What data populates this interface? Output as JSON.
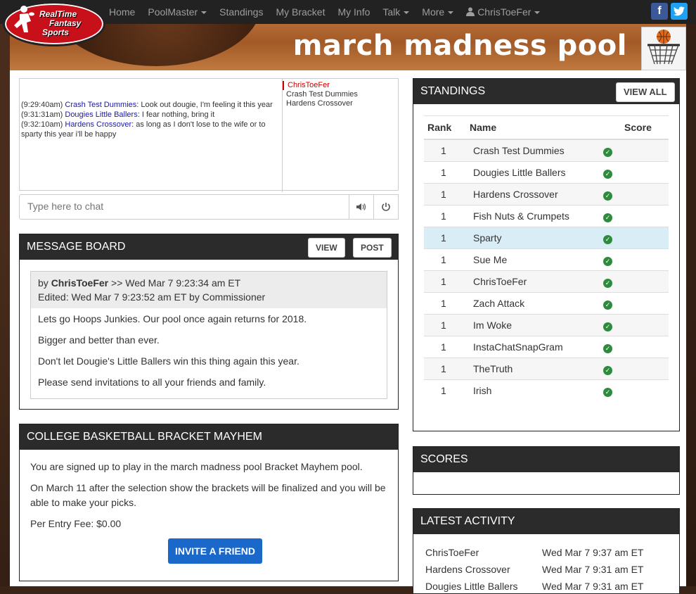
{
  "brand": {
    "line1": "RealTime",
    "line2": "Fantasy",
    "line3": "Sports"
  },
  "nav": {
    "home": "Home",
    "poolmaster": "PoolMaster",
    "standings": "Standings",
    "bracket": "My Bracket",
    "info": "My Info",
    "talk": "Talk",
    "more": "More",
    "user": "ChrisToeFer"
  },
  "banner": {
    "title": "march madness pool"
  },
  "chat": {
    "messages": [
      {
        "time": "(9:29:40am)",
        "who": "Crash Test Dummies",
        "text": ": Look out dougie, I'm feeling it this year"
      },
      {
        "time": "(9:31:31am)",
        "who": "Dougies Little Ballers",
        "text": ": I fear nothing, bring it"
      },
      {
        "time": "(9:32:10am)",
        "who": "Hardens Crossover",
        "text": ": as long as I don't lose to the wife or to sparty this year i'll be happy"
      }
    ],
    "users": [
      "ChrisToeFer",
      "Crash Test Dummies",
      "Hardens Crossover"
    ],
    "placeholder": "Type here to chat"
  },
  "message_board": {
    "title": "MESSAGE BOARD",
    "view_label": "VIEW",
    "post_label": "POST",
    "by_prefix": "by ",
    "author": "ChrisToeFer",
    "posted": " >> Wed Mar 7 9:23:34 am ET",
    "edited": "Edited: Wed Mar 7 9:23:52 am ET by Commissioner",
    "paragraphs": [
      "Lets go Hoops Junkies. Our pool once again returns for 2018.",
      "Bigger and better than ever.",
      "Don't let Dougie's Little Ballers win this thing again this year.",
      "Please send invitations to all your friends and family."
    ]
  },
  "bracket_panel": {
    "title": "COLLEGE BASKETBALL BRACKET MAYHEM",
    "p1": "You are signed up to play in the march madness pool Bracket Mayhem pool.",
    "p2": "On March 11 after the selection show the brackets will be finalized and you will be able to make your picks.",
    "fee": "Per Entry Fee: $0.00",
    "invite_label": "INVITE A FRIEND"
  },
  "standings": {
    "title": "STANDINGS",
    "view_all_label": "VIEW ALL",
    "headers": [
      "Rank",
      "Name",
      "Score"
    ],
    "rows": [
      {
        "rank": "1",
        "name": "Crash Test Dummies"
      },
      {
        "rank": "1",
        "name": "Dougies Little Ballers"
      },
      {
        "rank": "1",
        "name": "Hardens Crossover"
      },
      {
        "rank": "1",
        "name": "Fish Nuts & Crumpets"
      },
      {
        "rank": "1",
        "name": "Sparty"
      },
      {
        "rank": "1",
        "name": "Sue Me"
      },
      {
        "rank": "1",
        "name": "ChrisToeFer"
      },
      {
        "rank": "1",
        "name": "Zach Attack"
      },
      {
        "rank": "1",
        "name": "Im Woke"
      },
      {
        "rank": "1",
        "name": "InstaChatSnapGram"
      },
      {
        "rank": "1",
        "name": "TheTruth"
      },
      {
        "rank": "1",
        "name": "Irish"
      }
    ]
  },
  "scores": {
    "title": "SCORES"
  },
  "activity": {
    "title": "LATEST ACTIVITY",
    "rows": [
      {
        "name": "ChrisToeFer",
        "time": "Wed Mar 7 9:37 am ET"
      },
      {
        "name": "Hardens Crossover",
        "time": "Wed Mar 7 9:31 am ET"
      },
      {
        "name": "Dougies Little Ballers",
        "time": "Wed Mar 7 9:31 am ET"
      }
    ]
  }
}
